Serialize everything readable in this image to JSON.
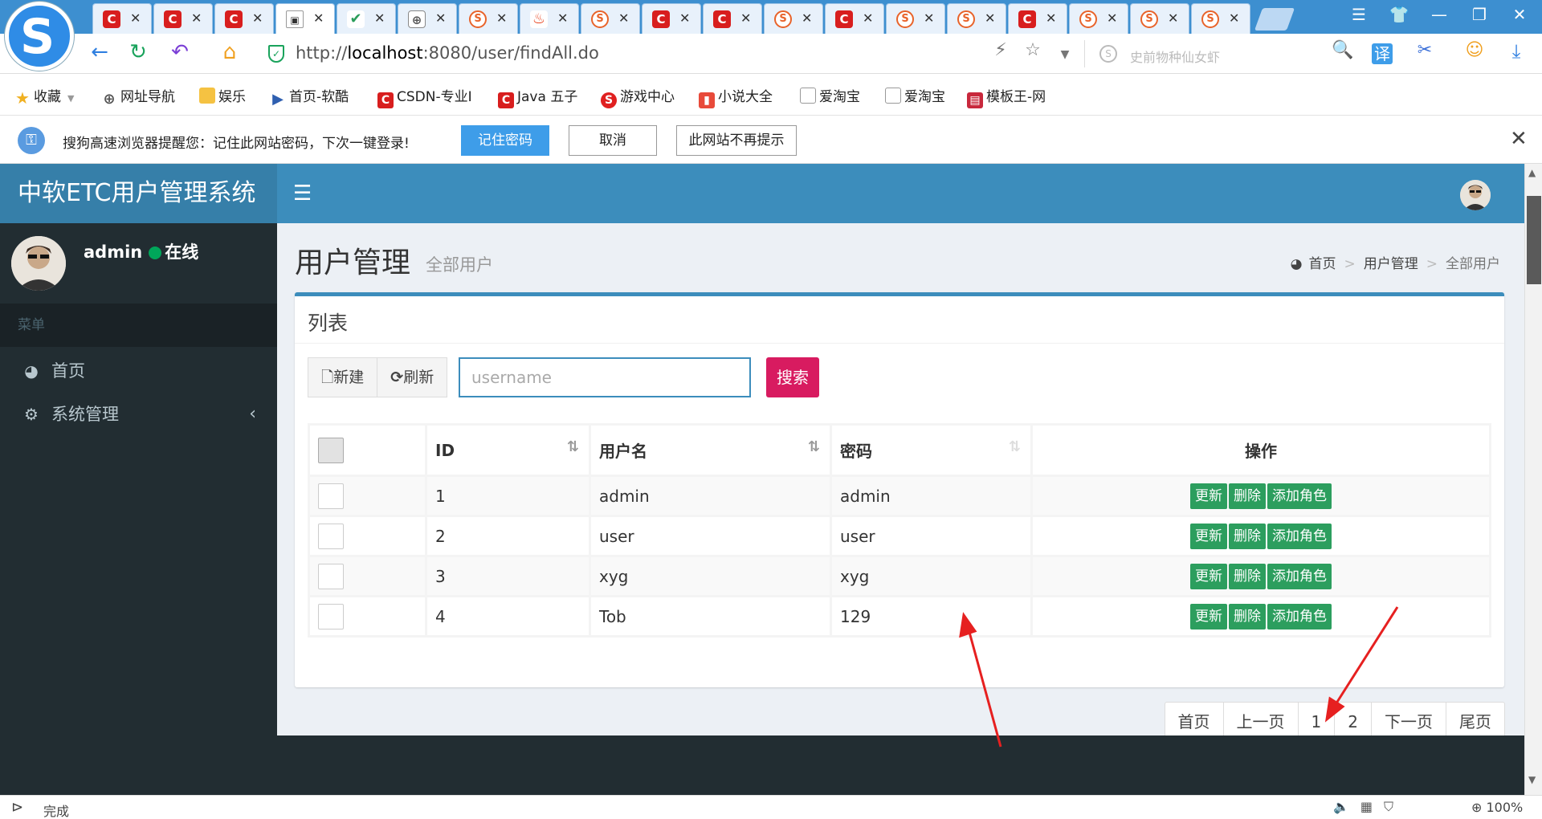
{
  "browser": {
    "tabs": [
      {
        "icon": "c-icon"
      },
      {
        "icon": "c-icon"
      },
      {
        "icon": "c-icon"
      },
      {
        "icon": "page-icon",
        "active": true
      },
      {
        "icon": "check-icon"
      },
      {
        "icon": "globe-icon"
      },
      {
        "icon": "s-icon"
      },
      {
        "icon": "fire-icon"
      },
      {
        "icon": "s-icon"
      },
      {
        "icon": "c-icon"
      },
      {
        "icon": "c-icon"
      },
      {
        "icon": "s-icon"
      },
      {
        "icon": "c-icon"
      },
      {
        "icon": "s-icon"
      },
      {
        "icon": "s-icon"
      },
      {
        "icon": "c-icon"
      },
      {
        "icon": "s-icon"
      },
      {
        "icon": "s-icon"
      },
      {
        "icon": "s-icon"
      }
    ],
    "url_prefix": "http://",
    "url_host": "localhost",
    "url_rest": ":8080/user/findAll.do",
    "search_placeholder": "史前物种仙女虾",
    "bookmarks": [
      {
        "label": "收藏",
        "icon": "star-icon"
      },
      {
        "label": "网址导航",
        "icon": "globe-icon"
      },
      {
        "label": "娱乐",
        "icon": "folder-icon"
      },
      {
        "label": "首页-软酷",
        "icon": "play-icon"
      },
      {
        "label": "CSDN-专业I",
        "icon": "csdn-icon"
      },
      {
        "label": "Java 五子",
        "icon": "csdn-icon"
      },
      {
        "label": "游戏中心",
        "icon": "game-icon"
      },
      {
        "label": "小说大全",
        "icon": "book-icon"
      },
      {
        "label": "爱淘宝",
        "icon": "page-icon"
      },
      {
        "label": "爱淘宝",
        "icon": "page-icon"
      },
      {
        "label": "模板王-网",
        "icon": "template-icon"
      }
    ],
    "password_prompt": {
      "message": "搜狗高速浏览器提醒您：记住此网站密码，下次一键登录!",
      "remember": "记住密码",
      "cancel": "取消",
      "never": "此网站不再提示"
    },
    "status_text": "完成",
    "zoom": "100%"
  },
  "app": {
    "brand": "中软ETC用户管理系统",
    "user": {
      "name": "admin",
      "status": "在线"
    },
    "menu_header": "菜单",
    "menu": [
      {
        "label": "首页",
        "icon": "dashboard-icon"
      },
      {
        "label": "系统管理",
        "icon": "cogs-icon"
      }
    ],
    "page_title": "用户管理",
    "page_subtitle": "全部用户",
    "breadcrumb": [
      "首页",
      "用户管理",
      "全部用户"
    ],
    "box_title": "列表",
    "toolbar": {
      "new": "新建",
      "refresh": "刷新",
      "search": "搜索",
      "search_placeholder": "username"
    },
    "table": {
      "headers": [
        "ID",
        "用户名",
        "密码",
        "操作"
      ],
      "rows": [
        {
          "id": "1",
          "username": "admin",
          "password": "admin"
        },
        {
          "id": "2",
          "username": "user",
          "password": "user"
        },
        {
          "id": "3",
          "username": "xyg",
          "password": "xyg"
        },
        {
          "id": "4",
          "username": "Tob",
          "password": "129"
        }
      ],
      "actions": [
        "更新",
        "删除",
        "添加角色"
      ]
    },
    "pagination": [
      "首页",
      "上一页",
      "1",
      "2",
      "下一页",
      "尾页"
    ]
  },
  "colors": {
    "header": "#3c8dbc",
    "brand": "#367fa9",
    "sidebar": "#222d32",
    "search_button": "#d81b60",
    "action_button": "#2c9e5e",
    "annotation_arrow": "#e62020"
  }
}
